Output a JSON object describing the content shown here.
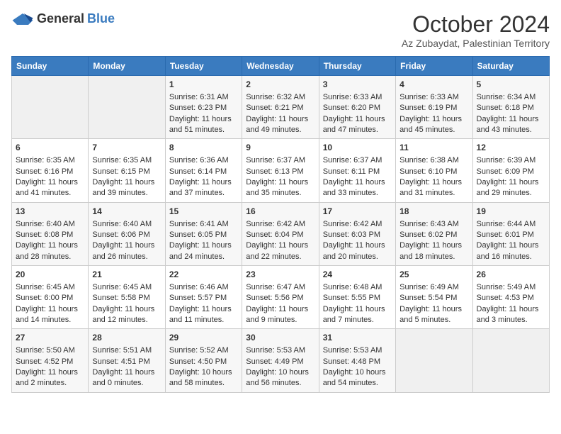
{
  "header": {
    "logo_general": "General",
    "logo_blue": "Blue",
    "month": "October 2024",
    "location": "Az Zubaydat, Palestinian Territory"
  },
  "days_of_week": [
    "Sunday",
    "Monday",
    "Tuesday",
    "Wednesday",
    "Thursday",
    "Friday",
    "Saturday"
  ],
  "weeks": [
    [
      {
        "day": "",
        "sunrise": "",
        "sunset": "",
        "daylight": "",
        "empty": true
      },
      {
        "day": "",
        "sunrise": "",
        "sunset": "",
        "daylight": "",
        "empty": true
      },
      {
        "day": "1",
        "sunrise": "Sunrise: 6:31 AM",
        "sunset": "Sunset: 6:23 PM",
        "daylight": "Daylight: 11 hours and 51 minutes."
      },
      {
        "day": "2",
        "sunrise": "Sunrise: 6:32 AM",
        "sunset": "Sunset: 6:21 PM",
        "daylight": "Daylight: 11 hours and 49 minutes."
      },
      {
        "day": "3",
        "sunrise": "Sunrise: 6:33 AM",
        "sunset": "Sunset: 6:20 PM",
        "daylight": "Daylight: 11 hours and 47 minutes."
      },
      {
        "day": "4",
        "sunrise": "Sunrise: 6:33 AM",
        "sunset": "Sunset: 6:19 PM",
        "daylight": "Daylight: 11 hours and 45 minutes."
      },
      {
        "day": "5",
        "sunrise": "Sunrise: 6:34 AM",
        "sunset": "Sunset: 6:18 PM",
        "daylight": "Daylight: 11 hours and 43 minutes."
      }
    ],
    [
      {
        "day": "6",
        "sunrise": "Sunrise: 6:35 AM",
        "sunset": "Sunset: 6:16 PM",
        "daylight": "Daylight: 11 hours and 41 minutes."
      },
      {
        "day": "7",
        "sunrise": "Sunrise: 6:35 AM",
        "sunset": "Sunset: 6:15 PM",
        "daylight": "Daylight: 11 hours and 39 minutes."
      },
      {
        "day": "8",
        "sunrise": "Sunrise: 6:36 AM",
        "sunset": "Sunset: 6:14 PM",
        "daylight": "Daylight: 11 hours and 37 minutes."
      },
      {
        "day": "9",
        "sunrise": "Sunrise: 6:37 AM",
        "sunset": "Sunset: 6:13 PM",
        "daylight": "Daylight: 11 hours and 35 minutes."
      },
      {
        "day": "10",
        "sunrise": "Sunrise: 6:37 AM",
        "sunset": "Sunset: 6:11 PM",
        "daylight": "Daylight: 11 hours and 33 minutes."
      },
      {
        "day": "11",
        "sunrise": "Sunrise: 6:38 AM",
        "sunset": "Sunset: 6:10 PM",
        "daylight": "Daylight: 11 hours and 31 minutes."
      },
      {
        "day": "12",
        "sunrise": "Sunrise: 6:39 AM",
        "sunset": "Sunset: 6:09 PM",
        "daylight": "Daylight: 11 hours and 29 minutes."
      }
    ],
    [
      {
        "day": "13",
        "sunrise": "Sunrise: 6:40 AM",
        "sunset": "Sunset: 6:08 PM",
        "daylight": "Daylight: 11 hours and 28 minutes."
      },
      {
        "day": "14",
        "sunrise": "Sunrise: 6:40 AM",
        "sunset": "Sunset: 6:06 PM",
        "daylight": "Daylight: 11 hours and 26 minutes."
      },
      {
        "day": "15",
        "sunrise": "Sunrise: 6:41 AM",
        "sunset": "Sunset: 6:05 PM",
        "daylight": "Daylight: 11 hours and 24 minutes."
      },
      {
        "day": "16",
        "sunrise": "Sunrise: 6:42 AM",
        "sunset": "Sunset: 6:04 PM",
        "daylight": "Daylight: 11 hours and 22 minutes."
      },
      {
        "day": "17",
        "sunrise": "Sunrise: 6:42 AM",
        "sunset": "Sunset: 6:03 PM",
        "daylight": "Daylight: 11 hours and 20 minutes."
      },
      {
        "day": "18",
        "sunrise": "Sunrise: 6:43 AM",
        "sunset": "Sunset: 6:02 PM",
        "daylight": "Daylight: 11 hours and 18 minutes."
      },
      {
        "day": "19",
        "sunrise": "Sunrise: 6:44 AM",
        "sunset": "Sunset: 6:01 PM",
        "daylight": "Daylight: 11 hours and 16 minutes."
      }
    ],
    [
      {
        "day": "20",
        "sunrise": "Sunrise: 6:45 AM",
        "sunset": "Sunset: 6:00 PM",
        "daylight": "Daylight: 11 hours and 14 minutes."
      },
      {
        "day": "21",
        "sunrise": "Sunrise: 6:45 AM",
        "sunset": "Sunset: 5:58 PM",
        "daylight": "Daylight: 11 hours and 12 minutes."
      },
      {
        "day": "22",
        "sunrise": "Sunrise: 6:46 AM",
        "sunset": "Sunset: 5:57 PM",
        "daylight": "Daylight: 11 hours and 11 minutes."
      },
      {
        "day": "23",
        "sunrise": "Sunrise: 6:47 AM",
        "sunset": "Sunset: 5:56 PM",
        "daylight": "Daylight: 11 hours and 9 minutes."
      },
      {
        "day": "24",
        "sunrise": "Sunrise: 6:48 AM",
        "sunset": "Sunset: 5:55 PM",
        "daylight": "Daylight: 11 hours and 7 minutes."
      },
      {
        "day": "25",
        "sunrise": "Sunrise: 6:49 AM",
        "sunset": "Sunset: 5:54 PM",
        "daylight": "Daylight: 11 hours and 5 minutes."
      },
      {
        "day": "26",
        "sunrise": "Sunrise: 5:49 AM",
        "sunset": "Sunset: 4:53 PM",
        "daylight": "Daylight: 11 hours and 3 minutes."
      }
    ],
    [
      {
        "day": "27",
        "sunrise": "Sunrise: 5:50 AM",
        "sunset": "Sunset: 4:52 PM",
        "daylight": "Daylight: 11 hours and 2 minutes."
      },
      {
        "day": "28",
        "sunrise": "Sunrise: 5:51 AM",
        "sunset": "Sunset: 4:51 PM",
        "daylight": "Daylight: 11 hours and 0 minutes."
      },
      {
        "day": "29",
        "sunrise": "Sunrise: 5:52 AM",
        "sunset": "Sunset: 4:50 PM",
        "daylight": "Daylight: 10 hours and 58 minutes."
      },
      {
        "day": "30",
        "sunrise": "Sunrise: 5:53 AM",
        "sunset": "Sunset: 4:49 PM",
        "daylight": "Daylight: 10 hours and 56 minutes."
      },
      {
        "day": "31",
        "sunrise": "Sunrise: 5:53 AM",
        "sunset": "Sunset: 4:48 PM",
        "daylight": "Daylight: 10 hours and 54 minutes."
      },
      {
        "day": "",
        "sunrise": "",
        "sunset": "",
        "daylight": "",
        "empty": true
      },
      {
        "day": "",
        "sunrise": "",
        "sunset": "",
        "daylight": "",
        "empty": true
      }
    ]
  ]
}
